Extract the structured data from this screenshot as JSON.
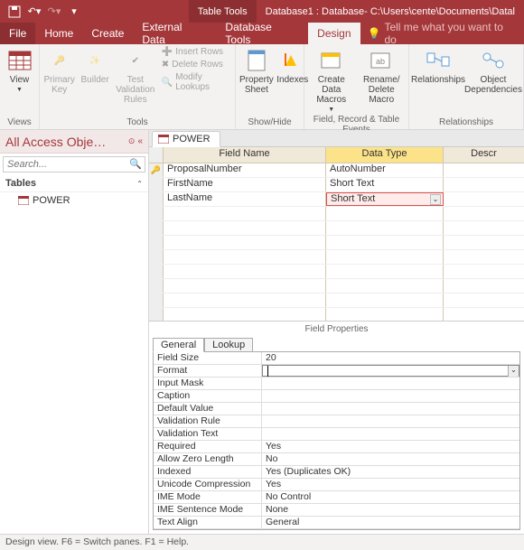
{
  "titlebar": {
    "context_tab": "Table Tools",
    "db_title": "Database1 : Database- C:\\Users\\cente\\Documents\\Datal"
  },
  "menu": {
    "file": "File",
    "home": "Home",
    "create": "Create",
    "external": "External Data",
    "dbtools": "Database Tools",
    "design": "Design",
    "tellme": "Tell me what you want to do"
  },
  "ribbon": {
    "view": "View",
    "primary_key": "Primary Key",
    "builder": "Builder",
    "test_validation": "Test Validation Rules",
    "insert_rows": "Insert Rows",
    "delete_rows": "Delete Rows",
    "modify_lookups": "Modify Lookups",
    "property_sheet": "Property Sheet",
    "indexes": "Indexes",
    "create_macros": "Create Data Macros",
    "rename_delete": "Rename/ Delete Macro",
    "relationships": "Relationships",
    "obj_dep": "Object Dependencies",
    "grp_views": "Views",
    "grp_tools": "Tools",
    "grp_showhide": "Show/Hide",
    "grp_events": "Field, Record & Table Events",
    "grp_rel": "Relationships"
  },
  "nav": {
    "title": "All Access Obje…",
    "search_placeholder": "Search...",
    "group": "Tables",
    "item1": "POWER"
  },
  "doc": {
    "tab": "POWER"
  },
  "grid": {
    "hdr_field": "Field Name",
    "hdr_type": "Data Type",
    "hdr_desc": "Descr",
    "rows": [
      {
        "key": true,
        "field": "ProposalNumber",
        "type": "AutoNumber"
      },
      {
        "key": false,
        "field": "FirstName",
        "type": "Short Text"
      },
      {
        "key": false,
        "field": "LastName",
        "type": "Short Text",
        "active": true
      }
    ],
    "fp_label": "Field Properties"
  },
  "props": {
    "tab_general": "General",
    "tab_lookup": "Lookup",
    "rows": [
      {
        "name": "Field Size",
        "val": "20"
      },
      {
        "name": "Format",
        "val": "",
        "focus": true
      },
      {
        "name": "Input Mask",
        "val": ""
      },
      {
        "name": "Caption",
        "val": ""
      },
      {
        "name": "Default Value",
        "val": ""
      },
      {
        "name": "Validation Rule",
        "val": ""
      },
      {
        "name": "Validation Text",
        "val": ""
      },
      {
        "name": "Required",
        "val": "Yes"
      },
      {
        "name": "Allow Zero Length",
        "val": "No"
      },
      {
        "name": "Indexed",
        "val": "Yes (Duplicates OK)"
      },
      {
        "name": "Unicode Compression",
        "val": "Yes"
      },
      {
        "name": "IME Mode",
        "val": "No Control"
      },
      {
        "name": "IME Sentence Mode",
        "val": "None"
      },
      {
        "name": "Text Align",
        "val": "General"
      }
    ]
  },
  "status": "Design view.   F6 = Switch panes.   F1 = Help."
}
